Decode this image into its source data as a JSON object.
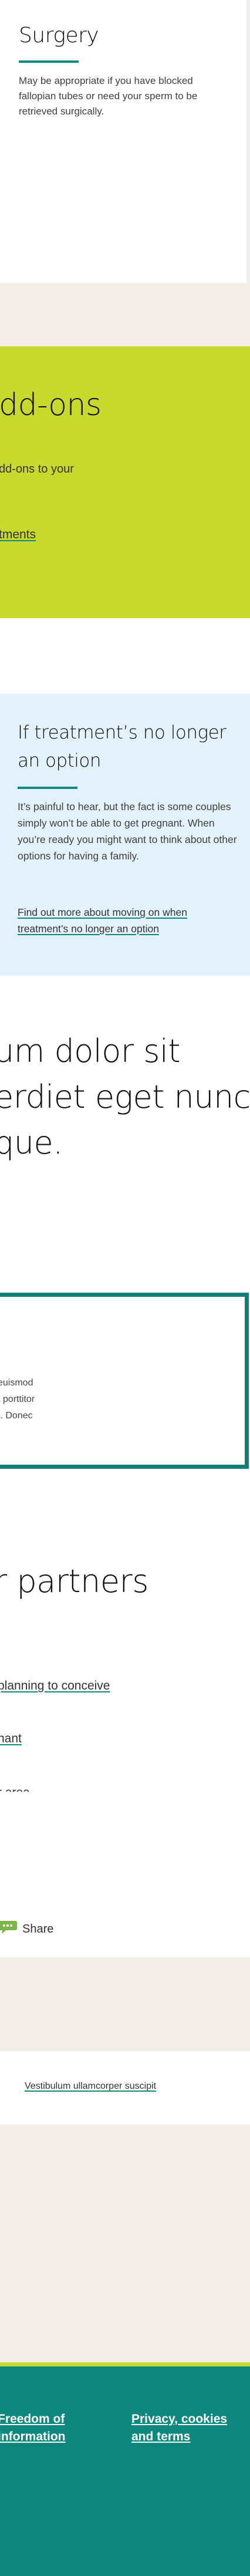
{
  "surgery": {
    "title": "Surgery",
    "body": "May be appropriate if you have blocked fallopian tubes or need your sperm to be retrieved surgically."
  },
  "addons": {
    "title": "dd-ons",
    "body": "dd-ons to your",
    "link": "tments"
  },
  "no_longer_option": {
    "title": "If treatment’s no longer an option",
    "body": "It’s painful to hear, but the fact is some couples simply won’t be able to get pregnant. When you’re ready you might want to think about other options for having a family.",
    "link": "Find out more about moving on when treatment’s no longer an option"
  },
  "quote": {
    "lines": [
      "um dolor sit",
      "erdiet eget nunc",
      "que."
    ]
  },
  "bordered_box": {
    "lines": [
      "euismod",
      "t porttitor",
      "t. Donec"
    ]
  },
  "partners": {
    "title": "r partners",
    "links": [
      "planning to conceive",
      "nant",
      "r area"
    ]
  },
  "share": {
    "label": "Share",
    "icon": "share-speech-bubble-icon",
    "icon_color": "#7ab648"
  },
  "related": {
    "link": "Vestibulum ullamcorper suscipit"
  },
  "footer": {
    "links": [
      "Freedom of information",
      "Privacy, cookies and terms"
    ]
  },
  "colors": {
    "accent": "#0e8a81",
    "lime": "#c7d92c",
    "light_blue": "#e2f1fa",
    "beige": "#f2ede6",
    "footer_teal": "#0e877f"
  }
}
